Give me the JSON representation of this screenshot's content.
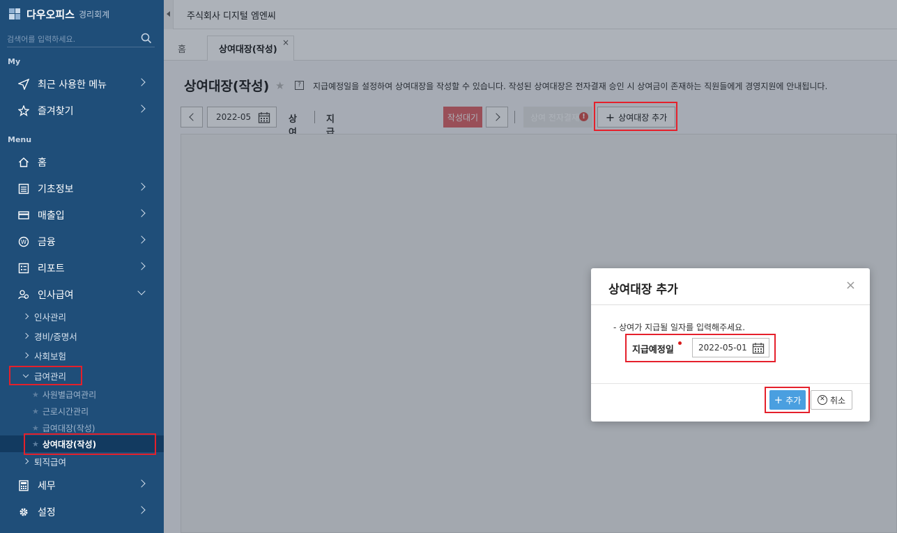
{
  "sidebar": {
    "logo_text": "다우오피스",
    "logo_sub": "경리회계",
    "search_placeholder": "검색어를 입력하세요.",
    "section_my": "My",
    "section_menu": "Menu",
    "my_items": [
      {
        "label": "최근 사용한 메뉴",
        "icon": "send-icon"
      },
      {
        "label": "즐겨찾기",
        "icon": "star-outline-icon"
      }
    ],
    "menu_items": [
      {
        "label": "홈",
        "icon": "home-icon"
      },
      {
        "label": "기초정보",
        "icon": "list-icon"
      },
      {
        "label": "매출입",
        "icon": "card-icon"
      },
      {
        "label": "금융",
        "icon": "won-icon"
      },
      {
        "label": "리포트",
        "icon": "report-icon"
      },
      {
        "label": "인사급여",
        "icon": "people-icon"
      }
    ],
    "hr_sub": [
      "인사관리",
      "경비/증명서",
      "사회보험",
      "급여관리"
    ],
    "payroll_sub": [
      "사원별급여관리",
      "근로시간관리",
      "급여대장(작성)",
      "상여대장(작성)"
    ],
    "hr_sub_after": "퇴직급여",
    "bottom_items": [
      {
        "label": "세무",
        "icon": "calculator-icon"
      },
      {
        "label": "설정",
        "icon": "gear-icon"
      }
    ]
  },
  "topbar": {
    "company": "주식회사 디지털 엠엔씨"
  },
  "tabs": {
    "home": "홈",
    "active": "상여대장(작성)",
    "close": "×"
  },
  "page": {
    "title": "상여대장(작성)",
    "help": "?",
    "description": "지급예정일을 설정하여 상여대장을 작성할 수 있습니다. 작성된 상여대장은 전자결재 승인 시 상여금이 존재하는 직원들에게 경영지원에 안내됩니다."
  },
  "toolbar": {
    "month": "2022-05",
    "type_label": "상여",
    "pay_date_label": "지급(예정)일:",
    "status": "작성대기",
    "approval": "상여 전자결재",
    "approval_warn": "!",
    "add": "상여대장 추가"
  },
  "modal": {
    "title": "상여대장 추가",
    "close": "×",
    "note": "- 상여가 지급될 일자를 입력해주세요.",
    "field_label": "지급예정일",
    "date_value": "2022-05-01",
    "add_button": "추가",
    "cancel_button": "취소"
  },
  "colors": {
    "sidebar_bg": "#1f4e79",
    "status_red": "#e0676b",
    "add_blue": "#4a9fe0",
    "highlight": "#e5202b"
  }
}
